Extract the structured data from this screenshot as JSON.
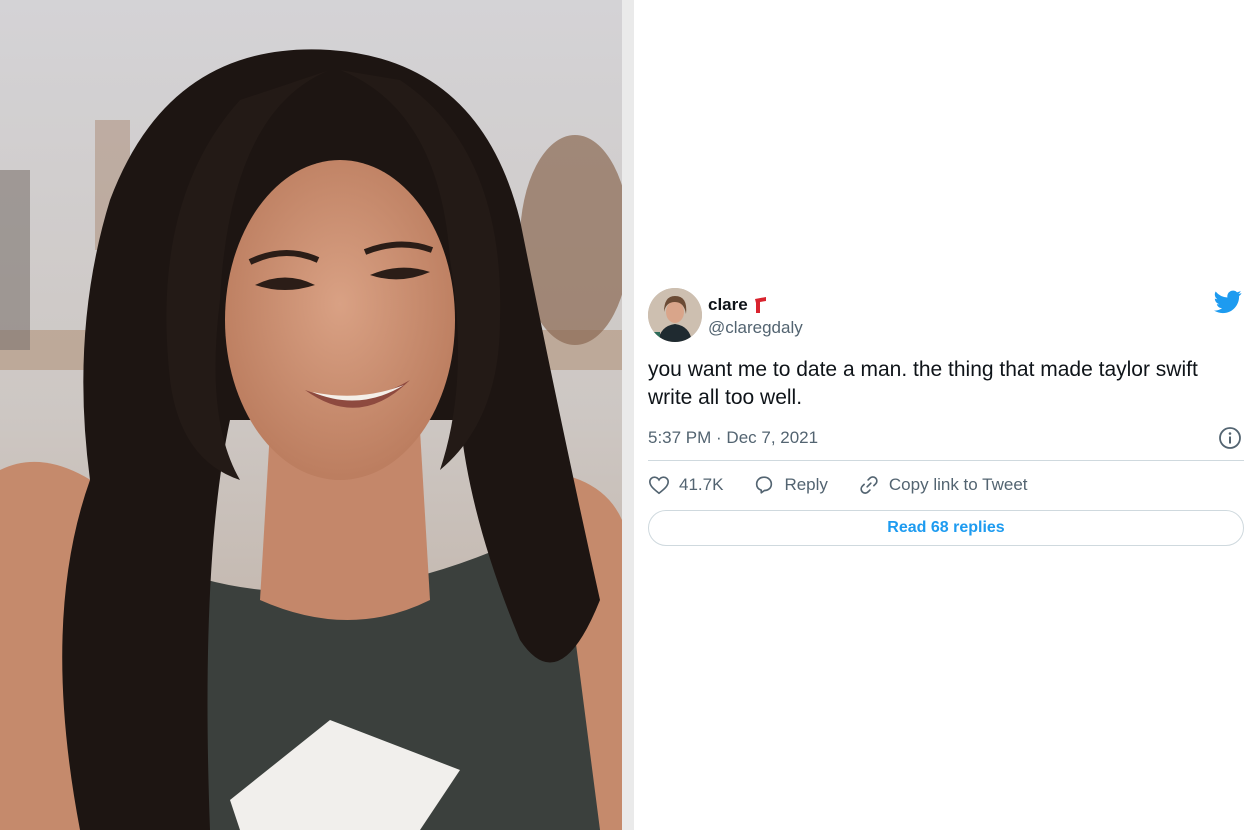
{
  "tweet": {
    "display_name": "clare",
    "handle": "@claregdaly",
    "text": "you want me to date a man. the thing that made taylor swift write all too well.",
    "timestamp": "5:37 PM · Dec 7, 2021",
    "likes": "41.7K",
    "reply_label": "Reply",
    "copy_link_label": "Copy link to Tweet",
    "read_replies_label": "Read 68 replies"
  },
  "icons": {
    "brand": "twitter-bird-icon",
    "info": "info-icon",
    "like": "heart-icon",
    "reply": "speech-bubble-icon",
    "copy": "link-icon",
    "name_emoji": "red-scarf-emoji"
  },
  "colors": {
    "accent": "#1d9bf0",
    "secondary_text": "#536471",
    "primary_text": "#0f1419",
    "border": "#cfd9de"
  }
}
